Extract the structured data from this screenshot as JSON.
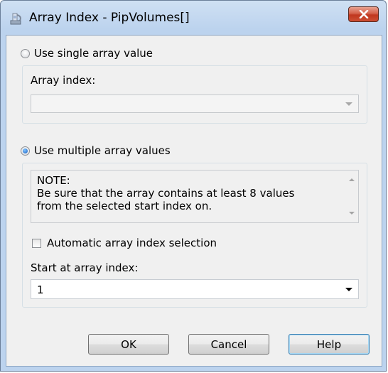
{
  "window": {
    "title": "Array Index - PipVolumes[]"
  },
  "single": {
    "radio_label": "Use single array value",
    "selected": false,
    "index_label": "Array index:",
    "index_value": ""
  },
  "multiple": {
    "radio_label": "Use multiple array values",
    "selected": true,
    "note_lines": [
      "NOTE:",
      "Be sure that the array contains at least 8 values",
      "from the selected start index on."
    ],
    "auto_label": "Automatic array index selection",
    "auto_checked": false,
    "start_label": "Start at array index:",
    "start_value": "1"
  },
  "buttons": {
    "ok": "OK",
    "cancel": "Cancel",
    "help": "Help"
  },
  "icons": {
    "app": "app-icon",
    "close": "close-icon"
  },
  "colors": {
    "close_button": "#c0381f",
    "frame": "#bcd3ee",
    "dialog_bg": "#f0f0f0"
  }
}
